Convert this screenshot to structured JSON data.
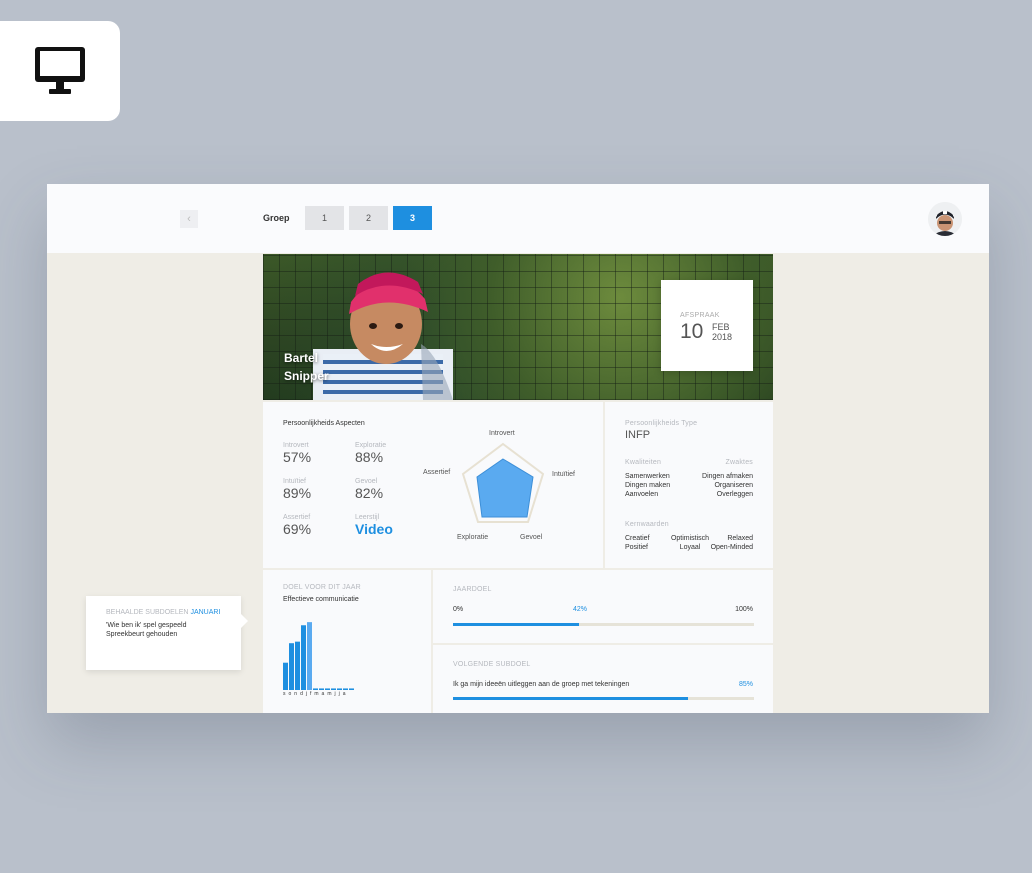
{
  "device_icon": "desktop-icon",
  "topbar": {
    "back_icon": "chevron-left-icon",
    "groep_label": "Groep",
    "tabs": [
      {
        "label": "1"
      },
      {
        "label": "2"
      },
      {
        "label": "3"
      }
    ],
    "active_tab": "3",
    "accent": "#1e8fe0"
  },
  "hero": {
    "first_name": "Bartel",
    "last_name": "Snipper"
  },
  "appointment": {
    "label": "AFSPRAAK",
    "day": "10",
    "month": "FEB",
    "year": "2018"
  },
  "aspects": {
    "title": "Persoonlijkheids Aspecten",
    "metrics": [
      {
        "label": "Introvert",
        "value": "57%"
      },
      {
        "label": "Exploratie",
        "value": "88%"
      },
      {
        "label": "Intuïtief",
        "value": "89%"
      },
      {
        "label": "Gevoel",
        "value": "82%"
      },
      {
        "label": "Assertief",
        "value": "69%"
      },
      {
        "label": "Leerstijl",
        "value": "Video"
      }
    ],
    "radar_labels": [
      "Introvert",
      "Intuïtief",
      "Gevoel",
      "Exploratie",
      "Assertief"
    ]
  },
  "type_panel": {
    "title": "Persoonlijkheids Type",
    "value": "INFP",
    "qualities_label": "Kwaliteiten",
    "weaknesses_label": "Zwaktes",
    "qualities": [
      "Samenwerken",
      "Dingen maken",
      "Aanvoelen"
    ],
    "weaknesses": [
      "Dingen afmaken",
      "Organiseren",
      "Overleggen"
    ],
    "core_values_label": "Kernwaarden",
    "core_values": [
      [
        "Creatief",
        "Optimistisch",
        "Relaxed"
      ],
      [
        "Positief",
        "Loyaal",
        "Open-Minded"
      ]
    ]
  },
  "goal": {
    "title": "DOEL VOOR DIT JAAR",
    "value": "Effectieve communicatie",
    "months": [
      "s",
      "o",
      "n",
      "d",
      "j",
      "f",
      "m",
      "a",
      "m",
      "j",
      "j",
      "a"
    ],
    "bars": [
      0.35,
      0.6,
      0.62,
      0.83,
      0.87,
      0.02,
      0.02,
      0.02,
      0.02,
      0.02,
      0.02,
      0.02
    ]
  },
  "year_goal": {
    "title": "JAARDOEL",
    "start": "0%",
    "current": "42%",
    "end": "100%",
    "progress": 0.42
  },
  "next_subgoal": {
    "title": "VOLGENDE SUBDOEL",
    "text": "Ik ga mijn ideeën uitleggen aan de groep met tekeningen",
    "percent": "85%",
    "progress": 0.78
  },
  "tooltip": {
    "title": "BEHAALDE SUBDOELEN",
    "month": "JANUARI",
    "items": [
      "'Wie ben ik' spel gespeeld",
      "Spreekbeurt gehouden"
    ]
  }
}
